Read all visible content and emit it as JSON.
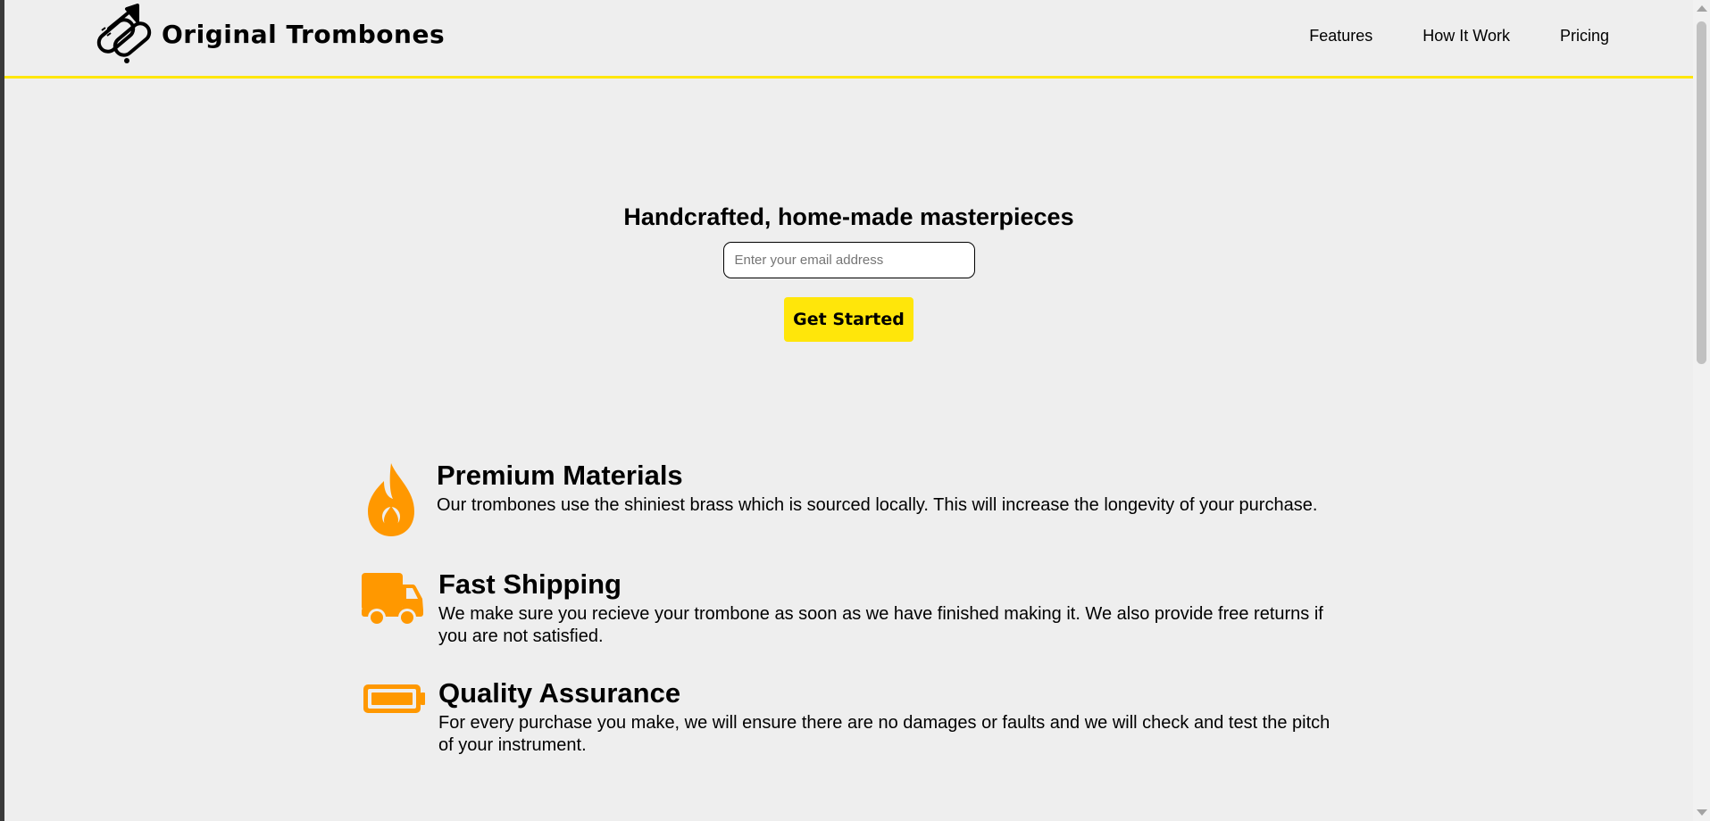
{
  "brand": {
    "name": "Original Trombones",
    "logo_icon": "trombone-icon"
  },
  "nav": {
    "items": [
      {
        "label": "Features"
      },
      {
        "label": "How It Work"
      },
      {
        "label": "Pricing"
      }
    ]
  },
  "hero": {
    "heading": "Handcrafted, home-made masterpieces",
    "email_placeholder": "Enter your email address",
    "cta_label": "Get Started"
  },
  "features": [
    {
      "icon": "flame-icon",
      "title": "Premium Materials",
      "description": "Our trombones use the shiniest brass which is sourced locally. This will increase the longevity of your purchase."
    },
    {
      "icon": "truck-icon",
      "title": "Fast Shipping",
      "description": "We make sure you recieve your trombone as soon as we have finished making it. We also provide free returns if you are not satisfied."
    },
    {
      "icon": "battery-icon",
      "title": "Quality Assurance",
      "description": "For every purchase you make, we will ensure there are no damages or faults and we will check and test the pitch of your instrument."
    }
  ],
  "colors": {
    "accent": "#ffe60a",
    "icon": "#ff9800",
    "background": "#eeeeee"
  }
}
